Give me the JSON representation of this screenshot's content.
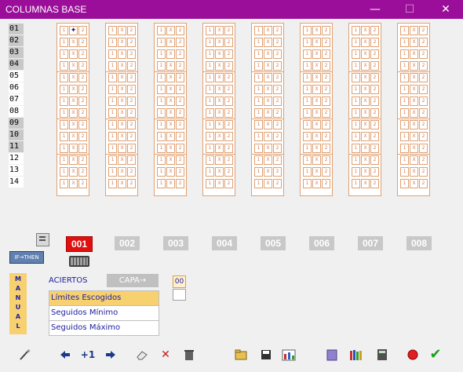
{
  "window": {
    "title": "COLUMNAS BASE",
    "minimize": "—",
    "maximize": "☐",
    "close": "✕"
  },
  "row_labels": [
    "01",
    "02",
    "03",
    "04",
    "05",
    "06",
    "07",
    "08",
    "09",
    "10",
    "11",
    "12",
    "13",
    "14"
  ],
  "row_label_gray": [
    true,
    true,
    true,
    true,
    false,
    false,
    false,
    false,
    true,
    true,
    true,
    false,
    false,
    false
  ],
  "grid": {
    "symbols": [
      "1",
      "X",
      "2"
    ],
    "columns": 8,
    "rows": 14,
    "marked": {
      "col": 0,
      "row": 0,
      "sym": 1,
      "glyph": "✦"
    }
  },
  "column_numbers": [
    "001",
    "002",
    "003",
    "004",
    "005",
    "006",
    "007",
    "008"
  ],
  "selected_column": "001",
  "if_then": "IF→THEN",
  "manual_letters": [
    "M",
    "A",
    "N",
    "U",
    "A",
    "L"
  ],
  "aciertos_label": "ACIERTOS",
  "capa_label": "CAPA→",
  "count_badge": "00",
  "list": [
    "Límites Escogidos",
    "Seguidos Mínimo",
    "Seguidos Máximo"
  ],
  "selected_list_item": "Límites Escogidos",
  "toolbar": {
    "step_label": "+1"
  },
  "icons": [
    "wand-icon",
    "arrow-left-icon",
    "arrow-right-icon",
    "eraser-icon",
    "delete-x-icon",
    "trash-icon",
    "folder-open-icon",
    "save-icon",
    "stats-icon",
    "notebook-icon",
    "books-icon",
    "calculator-icon",
    "record-icon",
    "check-icon",
    "keyboard-icon",
    "dropdown-icon"
  ],
  "colors": {
    "titlebar": "#9a0e9a",
    "accent_red": "#e01010",
    "highlight": "#f7d070",
    "grid_line": "#e0a070",
    "text_blue": "#2020a0"
  }
}
